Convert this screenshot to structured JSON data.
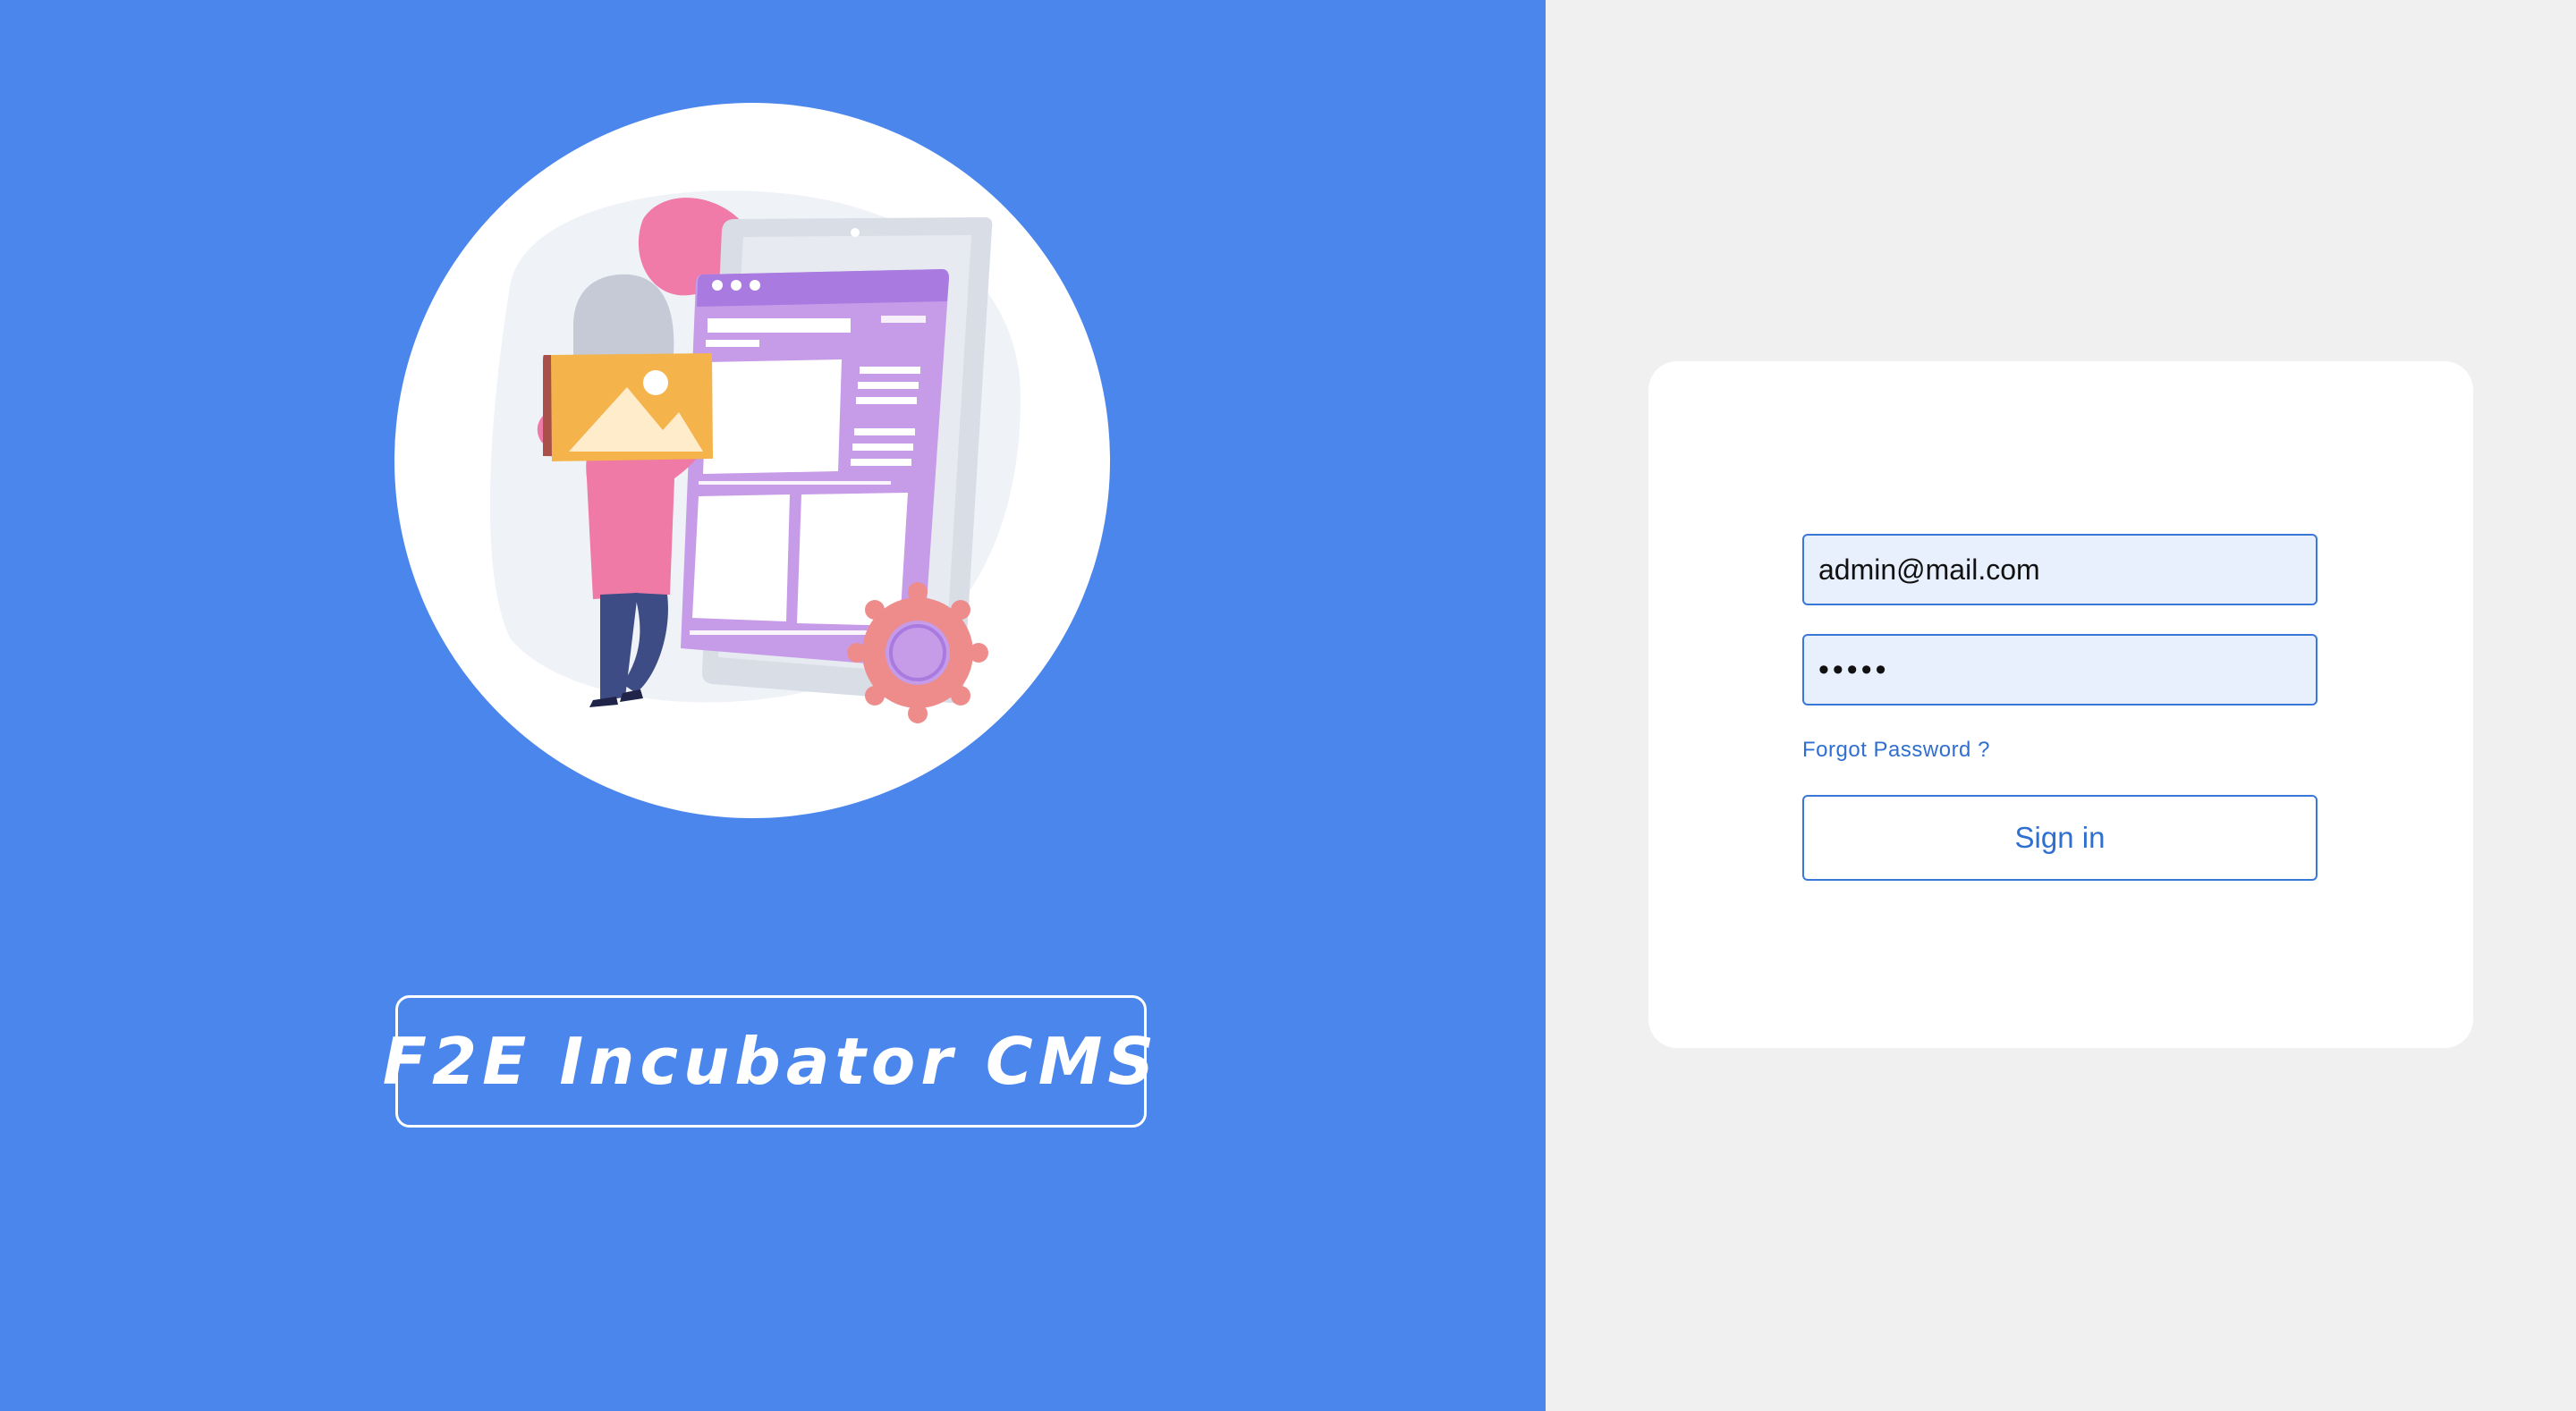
{
  "brand": {
    "title": "F2E Incubator CMS",
    "illustration": "person-with-mobile-cms-illustration"
  },
  "login": {
    "email_value": "admin@mail.com",
    "password_value": "•••••",
    "forgot_label": "Forgot Password ?",
    "sign_in_label": "Sign in"
  },
  "colors": {
    "left_background": "#4a86ec",
    "right_background": "#f0f0f0",
    "accent": "#3a78d8",
    "input_fill": "#e8effd"
  }
}
